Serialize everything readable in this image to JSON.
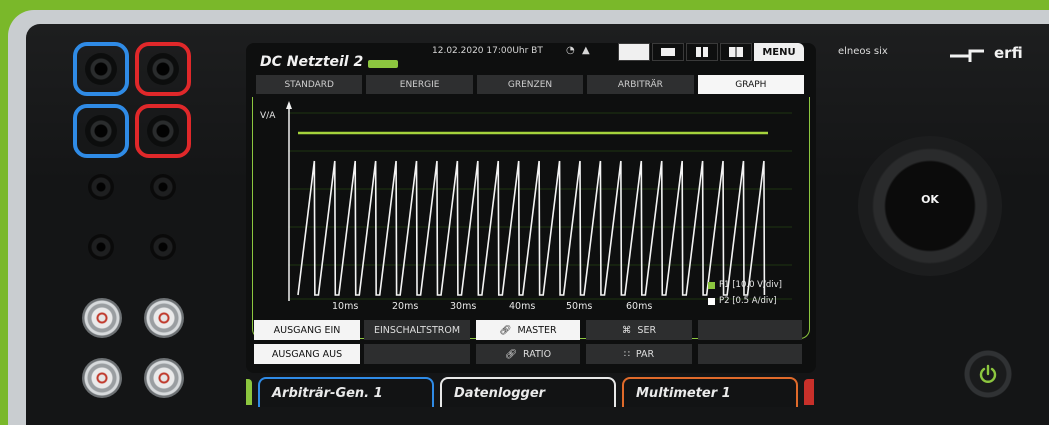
{
  "device": {
    "brand_small": "elneos six",
    "logo_text": "erfi",
    "ok_label": "OK"
  },
  "screen": {
    "title": "DC Netzteil 2",
    "status_text": "12.02.2020  17:00Uhr  BT",
    "menu_label": "MENU",
    "tabs": [
      {
        "label": "STANDARD",
        "active": false
      },
      {
        "label": "ENERGIE",
        "active": false
      },
      {
        "label": "GRENZEN",
        "active": false
      },
      {
        "label": "ARBITRÄR",
        "active": false
      },
      {
        "label": "GRAPH",
        "active": true
      }
    ],
    "graph": {
      "y_axis_label": "V/A",
      "x_ticks": [
        "10ms",
        "20ms",
        "30ms",
        "40ms",
        "50ms",
        "60ms"
      ],
      "legend": [
        {
          "label": "P1 [10.0 V/div]",
          "color": "#8cc63f"
        },
        {
          "label": "P2 [0.5 A/div]",
          "color": "#ffffff"
        }
      ]
    },
    "buttons": {
      "ausgang_ein": "AUSGANG EIN",
      "ausgang_aus": "AUSGANG AUS",
      "einschaltstrom": "EINSCHALTSTROM",
      "master": "MASTER",
      "ratio": "RATIO",
      "ser": "SER",
      "par": "PAR"
    },
    "bottom_tabs": [
      {
        "label": "Arbiträr-Gen. 1",
        "color": "#2f8be6"
      },
      {
        "label": "Datenlogger",
        "color": "#e8e8e8"
      },
      {
        "label": "Multimeter 1",
        "color": "#e06a2a"
      }
    ]
  },
  "colors": {
    "accent_green": "#8cc63f",
    "background_green": "#7ab82a",
    "jack_blue": "#2f8be6",
    "jack_red": "#e0282a"
  }
}
